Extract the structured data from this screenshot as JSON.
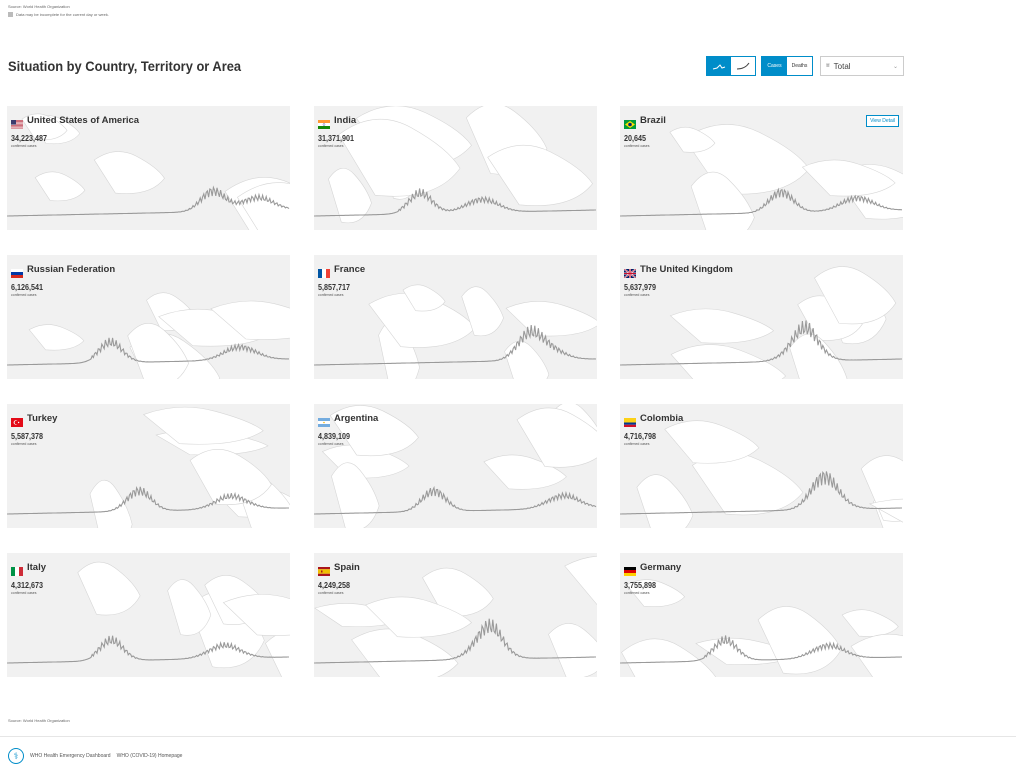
{
  "source_top": "Source: World Health Organization",
  "note": "Data may be incomplete for the current day or week.",
  "section_title": "Situation by Country, Territory or Area",
  "controls": {
    "chart_modes": [
      "daily-bars-icon",
      "cumulative-curve-icon"
    ],
    "metric_tabs": [
      "Cases",
      "Deaths"
    ],
    "dropdown_value": "Total",
    "accent": "#008dc9"
  },
  "cards": [
    {
      "country": "United States of America",
      "count": "34,223,487",
      "label": "confirmed cases",
      "flag": "us"
    },
    {
      "country": "India",
      "count": "31,371,901",
      "label": "confirmed cases",
      "flag": "in"
    },
    {
      "country": "Brazil",
      "count": "20,645",
      "label": "confirmed cases",
      "flag": "br",
      "view_detail": "View Detail"
    },
    {
      "country": "Russian Federation",
      "count": "6,126,541",
      "label": "confirmed cases",
      "flag": "ru"
    },
    {
      "country": "France",
      "count": "5,857,717",
      "label": "confirmed cases",
      "flag": "fr"
    },
    {
      "country": "The United Kingdom",
      "count": "5,637,979",
      "label": "confirmed cases",
      "flag": "gb"
    },
    {
      "country": "Turkey",
      "count": "5,587,378",
      "label": "confirmed cases",
      "flag": "tr"
    },
    {
      "country": "Argentina",
      "count": "4,839,109",
      "label": "confirmed cases",
      "flag": "ar"
    },
    {
      "country": "Colombia",
      "count": "4,716,798",
      "label": "confirmed cases",
      "flag": "co"
    },
    {
      "country": "Italy",
      "count": "4,312,673",
      "label": "confirmed cases",
      "flag": "it"
    },
    {
      "country": "Spain",
      "count": "4,249,258",
      "label": "confirmed cases",
      "flag": "es"
    },
    {
      "country": "Germany",
      "count": "3,755,898",
      "label": "confirmed cases",
      "flag": "de"
    }
  ],
  "source_bottom": "Source: World Health Organization",
  "footer": {
    "link1": "WHO Health Emergency Dashboard",
    "link2": "WHO (COVID-19) Homepage"
  }
}
